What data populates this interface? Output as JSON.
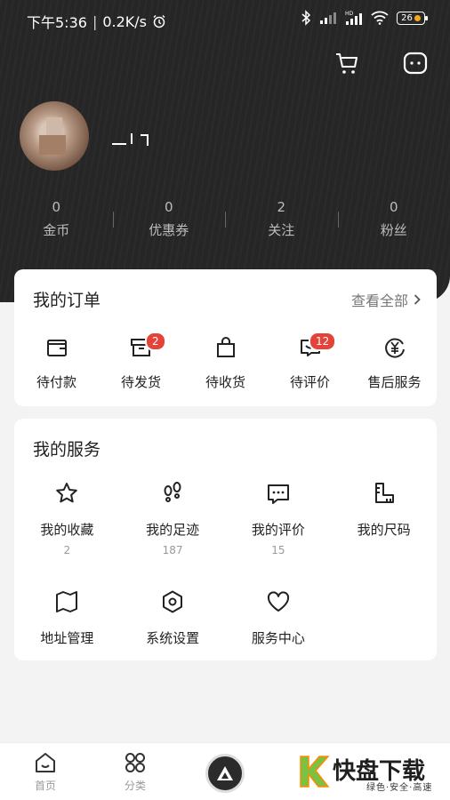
{
  "status_bar": {
    "time": "下午5:36",
    "speed": "0.2K/s",
    "battery": "26"
  },
  "header": {
    "icons": [
      "cart-icon",
      "message-icon"
    ],
    "stats": [
      {
        "value": "0",
        "label": "金币"
      },
      {
        "value": "0",
        "label": "优惠券"
      },
      {
        "value": "2",
        "label": "关注"
      },
      {
        "value": "0",
        "label": "粉丝"
      }
    ]
  },
  "orders": {
    "title": "我的订单",
    "view_all": "查看全部",
    "items": [
      {
        "label": "待付款",
        "icon": "wallet-icon"
      },
      {
        "label": "待发货",
        "icon": "box-icon",
        "badge": "2"
      },
      {
        "label": "待收货",
        "icon": "bag-icon"
      },
      {
        "label": "待评价",
        "icon": "review-icon",
        "badge": "12"
      },
      {
        "label": "售后服务",
        "icon": "refund-icon"
      }
    ]
  },
  "services": {
    "title": "我的服务",
    "items": [
      {
        "label": "我的收藏",
        "count": "2",
        "icon": "star-icon"
      },
      {
        "label": "我的足迹",
        "count": "187",
        "icon": "footprint-icon"
      },
      {
        "label": "我的评价",
        "count": "15",
        "icon": "comment-icon"
      },
      {
        "label": "我的尺码",
        "icon": "ruler-icon"
      },
      {
        "label": "地址管理",
        "icon": "map-icon"
      },
      {
        "label": "系统设置",
        "icon": "settings-icon"
      },
      {
        "label": "服务中心",
        "icon": "heart-icon"
      }
    ]
  },
  "tabbar": {
    "tabs": [
      {
        "label": "首页",
        "icon": "home-icon"
      },
      {
        "label": "分类",
        "icon": "category-icon"
      }
    ]
  },
  "watermark": {
    "title": "快盘下载",
    "subtitle": "绿色·安全·高速"
  }
}
